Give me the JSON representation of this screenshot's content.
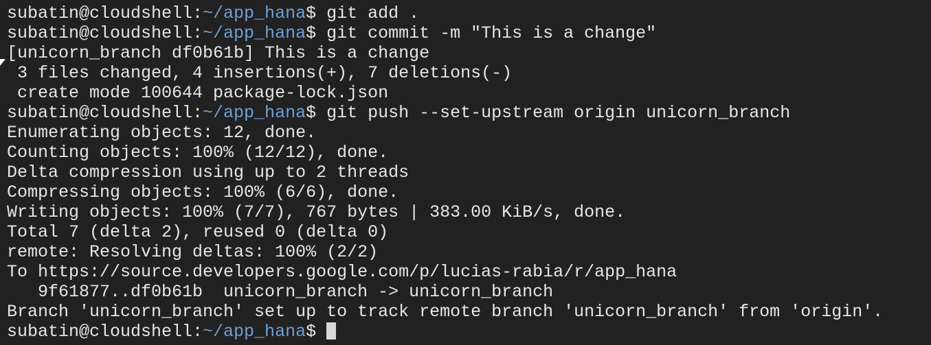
{
  "prompt": {
    "user_host": "subatin@cloudshell:",
    "path": "~/app_hana",
    "symbol": "$"
  },
  "commands": {
    "add": " git add .",
    "commit": " git commit -m \"This is a change\"",
    "push": " git push --set-upstream origin unicorn_branch"
  },
  "commit_output": [
    "[unicorn_branch df0b61b] This is a change",
    " 3 files changed, 4 insertions(+), 7 deletions(-)",
    " create mode 100644 package-lock.json"
  ],
  "push_output": [
    "Enumerating objects: 12, done.",
    "Counting objects: 100% (12/12), done.",
    "Delta compression using up to 2 threads",
    "Compressing objects: 100% (6/6), done.",
    "Writing objects: 100% (7/7), 767 bytes | 383.00 KiB/s, done.",
    "Total 7 (delta 2), reused 0 (delta 0)",
    "remote: Resolving deltas: 100% (2/2)",
    "To https://source.developers.google.com/p/lucias-rabia/r/app_hana",
    "   9f61877..df0b61b  unicorn_branch -> unicorn_branch",
    "Branch 'unicorn_branch' set up to track remote branch 'unicorn_branch' from 'origin'."
  ]
}
